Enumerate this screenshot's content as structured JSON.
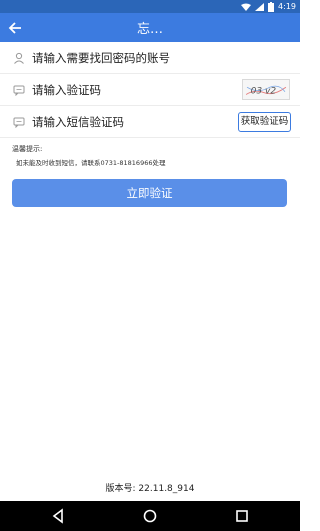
{
  "status_bar": {
    "time": "4:19",
    "bg_color": "#2b66b8"
  },
  "app_bar": {
    "title": "忘…",
    "bg_color": "#3c7be0",
    "back_icon": "arrow-left-icon"
  },
  "form": {
    "account_placeholder": "请输入需要找回密码的账号",
    "captcha_placeholder": "请输入验证码",
    "captcha_image_text": "03 v2",
    "sms_placeholder": "请输入短信验证码",
    "sms_button_label": "获取验证码"
  },
  "tips": {
    "title": "温馨提示:",
    "text": "如未能及时收到短信，请联系0731-81816966处理"
  },
  "verify_button_label": "立即验证",
  "version_text": "版本号: 22.11.8_914",
  "nav_bar": {
    "buttons": [
      "back-icon",
      "home-icon",
      "recents-icon"
    ]
  }
}
